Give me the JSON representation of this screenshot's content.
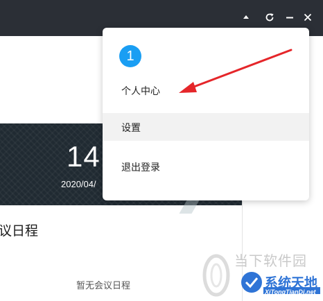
{
  "window": {
    "controls": [
      "arrow-up-icon",
      "refresh-icon",
      "minimize-icon",
      "close-icon"
    ]
  },
  "clock": {
    "time": "14:",
    "date": "2020/04/"
  },
  "meetings": {
    "title": "议日程",
    "empty_text": "暂无会议日程"
  },
  "dropdown": {
    "step_number": "1",
    "items": [
      "个人中心",
      "设置",
      "退出登录"
    ],
    "hovered_item": "设置"
  },
  "annotation": {
    "arrow_color": "#e5262a"
  },
  "watermark": {
    "line1": "当下软件园",
    "line2": "系统天地",
    "url": "XiTongTianDi.net"
  },
  "colors": {
    "titlebar": "#2b2f36",
    "accent": "#1a9ef3",
    "clock_bg": "#202a32"
  }
}
